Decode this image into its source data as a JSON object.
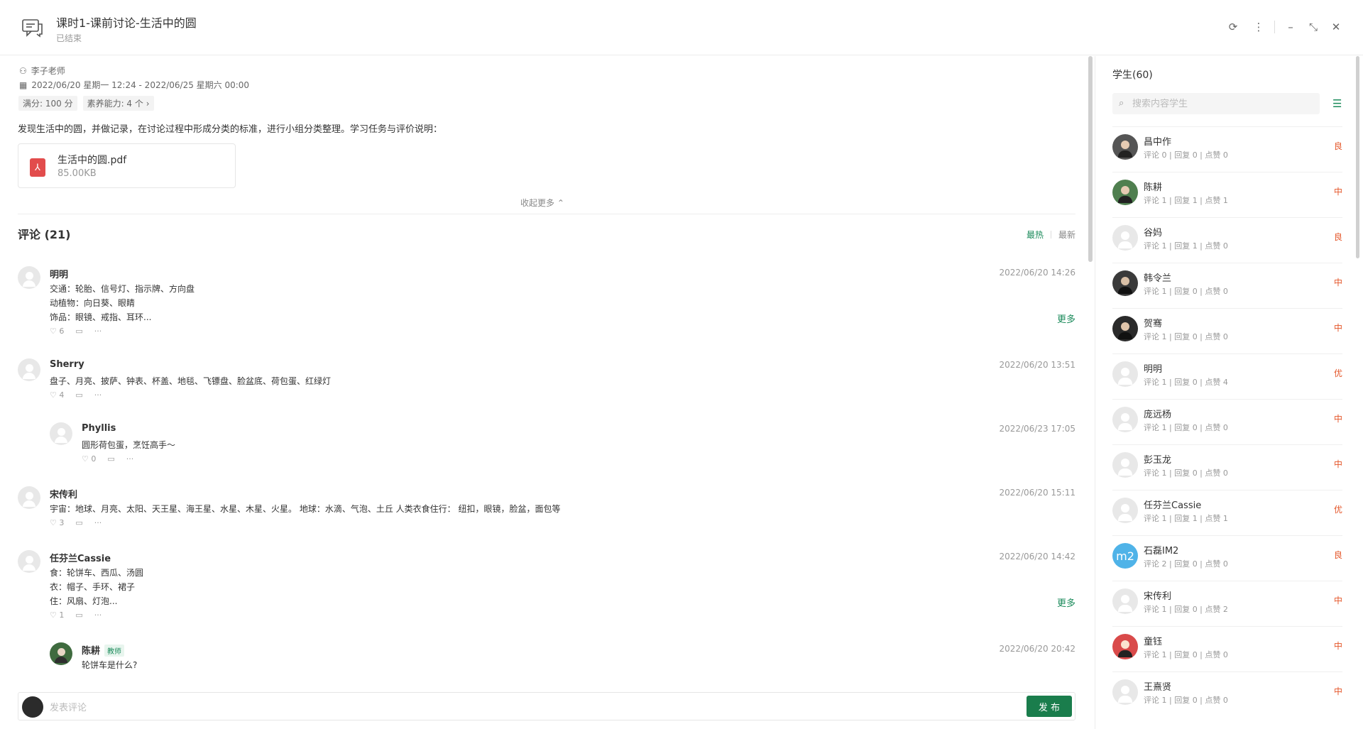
{
  "header": {
    "title": "课时1-课前讨论-生活中的圆",
    "status": "已结束"
  },
  "info": {
    "teacher": "李子老师",
    "time_range": "2022/06/20 星期一 12:24 - 2022/06/25 星期六 00:00",
    "score": "满分: 100 分",
    "literacy": "素养能力: 4 个",
    "description": "发现生活中的圆，并做记录，在讨论过程中形成分类的标准，进行小组分类整理。学习任务与评价说明：",
    "file_name": "生活中的圆.pdf",
    "file_size": "85.00KB",
    "collapse": "收起更多"
  },
  "comments_section": {
    "title": "评论 (21)",
    "sort_hot": "最热",
    "sort_new": "最新",
    "more": "更多"
  },
  "comments": [
    {
      "name": "明明",
      "time": "2022/06/20 14:26",
      "text": "交通：轮胎、信号灯、指示牌、方向盘\n动植物：向日葵、眼睛\n饰品：眼镜、戒指、耳环...",
      "likes": "6"
    },
    {
      "name": "Sherry",
      "time": "2022/06/20 13:51",
      "text": "盘子、月亮、披萨、钟表、杯盖、地毯、飞镖盘、脸盆底、荷包蛋、红绿灯",
      "likes": "4"
    },
    {
      "name": "Phyllis",
      "time": "2022/06/23 17:05",
      "text": "圆形荷包蛋，烹饪高手～",
      "likes": "0"
    },
    {
      "name": "宋传利",
      "time": "2022/06/20 15:11",
      "text": "宇宙：地球、月亮、太阳、天王星、海王星、水星、木星、火星。 地球：水滴、气泡、土丘 人类衣食住行： 纽扣，眼镜，脸盆，面包等",
      "likes": "3"
    },
    {
      "name": "任芬兰Cassie",
      "time": "2022/06/20 14:42",
      "text": "食：轮饼车、西瓜、汤圆\n衣：帽子、手环、裙子\n住：风扇、灯泡...",
      "likes": "1"
    },
    {
      "name": "陈耕",
      "badge": "教师",
      "time": "2022/06/20 20:42",
      "text": "轮饼车是什么?"
    }
  ],
  "footer": {
    "placeholder": "发表评论",
    "publish": "发 布"
  },
  "sidebar": {
    "title": "学生(60)",
    "search_placeholder": "搜索内容学生",
    "students": [
      {
        "name": "昌中作",
        "stats": "评论 0 | 回复 0 | 点赞 0",
        "grade": "良"
      },
      {
        "name": "陈耕",
        "stats": "评论 1 | 回复 1 | 点赞 1",
        "grade": "中"
      },
      {
        "name": "谷妈",
        "stats": "评论 1 | 回复 1 | 点赞 0",
        "grade": "良"
      },
      {
        "name": "韩令兰",
        "stats": "评论 1 | 回复 0 | 点赞 0",
        "grade": "中"
      },
      {
        "name": "贺骞",
        "stats": "评论 1 | 回复 0 | 点赞 0",
        "grade": "中"
      },
      {
        "name": "明明",
        "stats": "评论 1 | 回复 0 | 点赞 4",
        "grade": "优"
      },
      {
        "name": "庞远杨",
        "stats": "评论 1 | 回复 0 | 点赞 0",
        "grade": "中"
      },
      {
        "name": "彭玉龙",
        "stats": "评论 1 | 回复 0 | 点赞 0",
        "grade": "中"
      },
      {
        "name": "任芬兰Cassie",
        "stats": "评论 1 | 回复 1 | 点赞 1",
        "grade": "优"
      },
      {
        "name": "石磊IM2",
        "stats": "评论 2 | 回复 0 | 点赞 0",
        "grade": "良"
      },
      {
        "name": "宋传利",
        "stats": "评论 1 | 回复 0 | 点赞 2",
        "grade": "中"
      },
      {
        "name": "童钰",
        "stats": "评论 1 | 回复 0 | 点赞 0",
        "grade": "中"
      },
      {
        "name": "王熹贤",
        "stats": "评论 1 | 回复 0 | 点赞 0",
        "grade": "中"
      }
    ]
  }
}
